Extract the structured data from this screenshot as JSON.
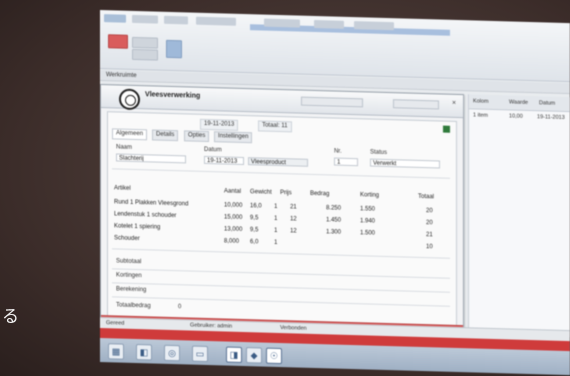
{
  "overlay_text": "る",
  "colors": {
    "accent_red": "#cf3b3b",
    "taskbar_blue": "#9fb0c4",
    "status_green": "#2f7a3b"
  },
  "ribbon": {
    "tabs": [
      "",
      "",
      "",
      "",
      "",
      "",
      ""
    ],
    "buttons": [
      "",
      "",
      "",
      ""
    ]
  },
  "workspace": {
    "label": "Werkruimte"
  },
  "dialog": {
    "title": "Vleesverwerking",
    "close_icon": "×",
    "top_badges": [
      "19-11-2013",
      "Totaal: 11"
    ],
    "tabs": [
      "Algemeen",
      "Details",
      "Opties",
      "Instellingen"
    ],
    "fields": {
      "left_label_1": "Naam",
      "left_value_1": "Slachterij",
      "left_label_2": "Datum",
      "left_value_2": "19-11-2013",
      "left_value_3": "Vleesproduct",
      "right_label_1": "Nr.",
      "right_value_1": "1",
      "right_label_2": "Status",
      "right_value_2": "Verwerkt"
    },
    "row_headers": [
      "Artikel",
      "Aantal",
      "Gewicht",
      "Prijs",
      "Bedrag",
      "Korting",
      "Totaal"
    ],
    "rows": [
      {
        "name": "Rund 1 Plakken Vleesgrond",
        "values": [
          "10,000",
          "16,0",
          "1",
          "21",
          "8.250",
          "1.550",
          "20"
        ]
      },
      {
        "name": "Lendenstuk 1 schouder",
        "values": [
          "15,000",
          "9,5",
          "1",
          "12",
          "1.450",
          "1.940",
          "20"
        ]
      },
      {
        "name": "Kotelet 1 spiering",
        "values": [
          "13,000",
          "9,5",
          "1",
          "12",
          "1.300",
          "1.500",
          "21"
        ]
      },
      {
        "name": "Schouder",
        "values": [
          "8,000",
          "6,0",
          "1",
          "",
          "",
          "",
          "10"
        ]
      }
    ],
    "summary_labels": [
      "Subtotaal",
      "Kortingen",
      "Berekening",
      "Totaalbedrag"
    ],
    "summary_value": "0"
  },
  "right_panel": {
    "headers": [
      "Kolom",
      "Waarde",
      "Datum"
    ],
    "rows": [
      [
        "1 item",
        "10,00",
        "19-11-2013"
      ]
    ]
  },
  "status_bar": {
    "left": "Gereed",
    "middle": "Gebruiker: admin",
    "right": "Verbonden"
  },
  "taskbar": {
    "icons": [
      "start-icon",
      "explorer-icon",
      "browser-icon",
      "folder-icon",
      "app-icon",
      "pin-icon",
      "logo-icon"
    ]
  }
}
